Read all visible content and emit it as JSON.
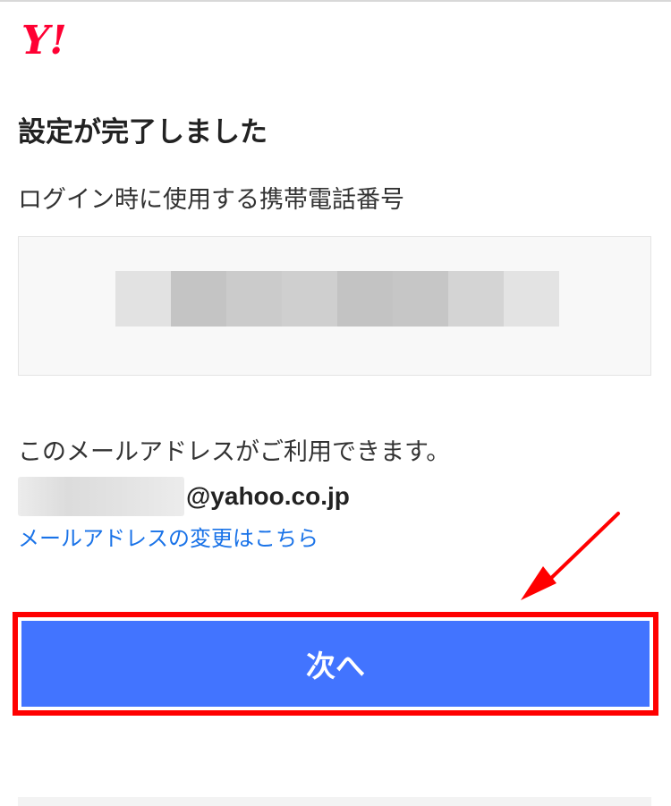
{
  "brand": {
    "logo_text": "Y!",
    "logo_color": "#ff0033"
  },
  "page": {
    "title": "設定が完了しました"
  },
  "phone": {
    "label": "ログイン時に使用する携帯電話番号",
    "value_masked": true
  },
  "mail": {
    "message": "このメールアドレスがご利用できます。",
    "address_domain": "@yahoo.co.jp",
    "change_link": "メールアドレスの変更はこちら"
  },
  "actions": {
    "next_label": "次へ"
  },
  "colors": {
    "accent": "#4274ff",
    "link": "#1a73e8",
    "highlight": "#ff0000"
  },
  "annotation": {
    "type": "arrow-and-frame",
    "target": "next-button"
  }
}
